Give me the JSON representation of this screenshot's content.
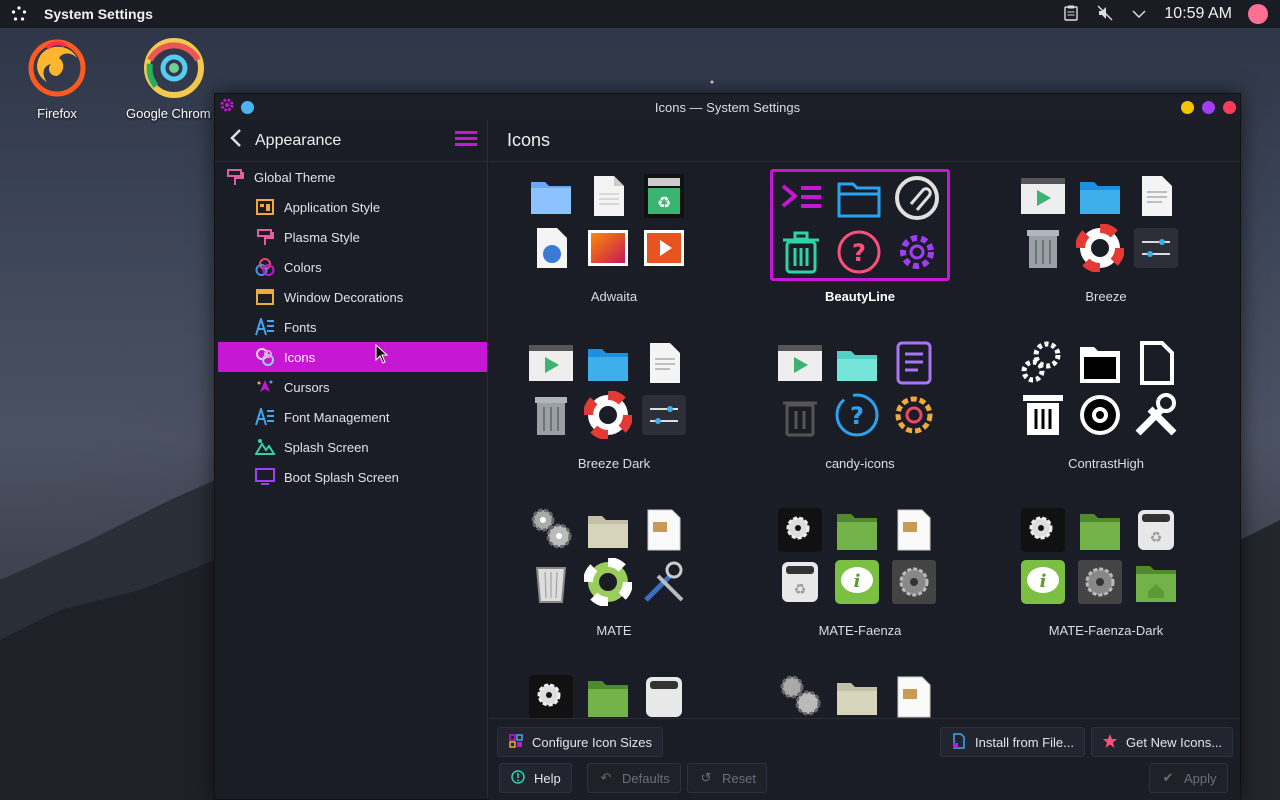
{
  "top_panel": {
    "app_title": "System Settings",
    "clock": "10:59 AM",
    "tray_icons": [
      "clipboard-icon",
      "volume-muted-icon",
      "chevron-down-icon"
    ]
  },
  "desktop": {
    "icons": [
      {
        "label": "Firefox",
        "icon": "firefox-icon"
      },
      {
        "label": "Google Chrom",
        "icon": "chrome-icon"
      }
    ]
  },
  "window": {
    "title": "Icons — System Settings",
    "controls": {
      "minimize": "#f5c400",
      "maximize": "#a13df5",
      "close": "#ff3b5c"
    }
  },
  "sidebar": {
    "header": "Appearance",
    "items": [
      {
        "label": "Global Theme",
        "level": "top"
      },
      {
        "label": "Application Style",
        "level": "sub"
      },
      {
        "label": "Plasma Style",
        "level": "sub"
      },
      {
        "label": "Colors",
        "level": "sub"
      },
      {
        "label": "Window Decorations",
        "level": "sub"
      },
      {
        "label": "Fonts",
        "level": "sub"
      },
      {
        "label": "Icons",
        "level": "sub",
        "active": true
      },
      {
        "label": "Cursors",
        "level": "sub"
      },
      {
        "label": "Font Management",
        "level": "sub"
      },
      {
        "label": "Splash Screen",
        "level": "sub"
      },
      {
        "label": "Boot Splash Screen",
        "level": "sub"
      }
    ]
  },
  "main": {
    "header": "Icons",
    "themes": [
      {
        "name": "Adwaita"
      },
      {
        "name": "BeautyLine",
        "selected": true
      },
      {
        "name": "Breeze"
      },
      {
        "name": "Breeze Dark"
      },
      {
        "name": "candy-icons"
      },
      {
        "name": "ContrastHigh"
      },
      {
        "name": "MATE"
      },
      {
        "name": "MATE-Faenza"
      },
      {
        "name": "MATE-Faenza-Dark"
      }
    ],
    "buttons": {
      "configure_sizes": "Configure Icon Sizes",
      "install_from_file": "Install from File...",
      "get_new": "Get New Icons...",
      "help": "Help",
      "defaults": "Defaults",
      "reset": "Reset",
      "apply": "Apply"
    }
  },
  "colors": {
    "accent": "#c517d4",
    "window_bg": "#1b1d26",
    "panel_bg": "#1a1c24"
  }
}
